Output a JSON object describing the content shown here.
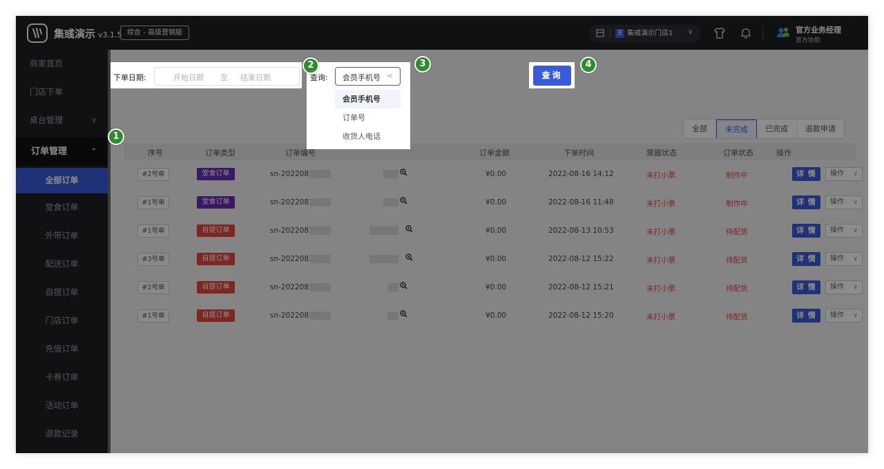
{
  "header": {
    "brand": "集彧演示",
    "version": "v3.1.5",
    "edition": "综合 - 高级营销版",
    "store_badge": "主",
    "store_name": "集彧演示门店1",
    "user_name": "官方业务经理",
    "user_role": "官方协助"
  },
  "sidebar": {
    "top_items": [
      "商家首页",
      "门店下单",
      "桌台管理"
    ],
    "group": "订单管理",
    "active": "全部订单",
    "sub_items": [
      "堂食订单",
      "外带订单",
      "配送订单",
      "自提订单",
      "门店订单",
      "充值订单",
      "卡券订单",
      "活动订单",
      "退款记录"
    ]
  },
  "filters": {
    "date_label": "下单日期:",
    "start_placeholder": "开始日期",
    "range_sep": "至",
    "end_placeholder": "结束日期",
    "query_label": "查询:",
    "query_field": "会员手机号",
    "dropdown_options": [
      "会员手机号",
      "订单号",
      "收货人电话"
    ],
    "query_button": "查询"
  },
  "markers": [
    "1",
    "2",
    "3",
    "4"
  ],
  "status_tabs": [
    "全部",
    "未完成",
    "已完成",
    "退款申请"
  ],
  "active_status_tab": "未完成",
  "table": {
    "columns": [
      "序号",
      "订单类型",
      "订单编号",
      "订单金额",
      "下单时间",
      "票据状态",
      "订单状态",
      "操作"
    ],
    "rows": [
      {
        "seq": "#2号单",
        "type": "堂食订单",
        "no": "sn-2022081",
        "amount": "¥0.00",
        "time": "2022-08-16 14:12",
        "receipt": "未打小票",
        "status": "制作中",
        "detail": "详 情",
        "op": "操作"
      },
      {
        "seq": "#1号单",
        "type": "堂食订单",
        "no": "sn-2022081",
        "amount": "¥0.00",
        "time": "2022-08-16 11:48",
        "receipt": "未打小票",
        "status": "制作中",
        "detail": "详 情",
        "op": "操作"
      },
      {
        "seq": "#1号单",
        "type": "自提订单",
        "no": "sn-2022081",
        "amount": "¥0.00",
        "time": "2022-08-13 10:53",
        "receipt": "未打小票",
        "status": "待配货",
        "detail": "详 情",
        "op": "操作"
      },
      {
        "seq": "#3号单",
        "type": "自提订单",
        "no": "sn-2022081",
        "amount": "¥0.00",
        "time": "2022-08-12 15:22",
        "receipt": "未打小票",
        "status": "待配货",
        "detail": "详 情",
        "op": "操作"
      },
      {
        "seq": "#2号单",
        "type": "自提订单",
        "no": "sn-2022081",
        "amount": "¥0.00",
        "time": "2022-08-12 15:21",
        "receipt": "未打小票",
        "status": "待配货",
        "detail": "详 情",
        "op": "操作"
      },
      {
        "seq": "#1号单",
        "type": "自提订单",
        "no": "sn-2022081",
        "amount": "¥0.00",
        "time": "2022-08-12 15:20",
        "receipt": "未打小票",
        "status": "待配货",
        "detail": "详 情",
        "op": "操作"
      }
    ]
  },
  "colors": {
    "accent": "#3a5bd9",
    "dine_in_tag": "#6b2fb6",
    "pickup_tag": "#e3473f",
    "marker": "#2e8b2e",
    "dim_overlay": "rgba(0,0,0,0.45)"
  },
  "icons": [
    "logo-icon",
    "store-icon",
    "shirt-icon",
    "bell-icon",
    "users-icon",
    "zoom-icon",
    "chevron-down-icon",
    "chevron-up-icon"
  ]
}
